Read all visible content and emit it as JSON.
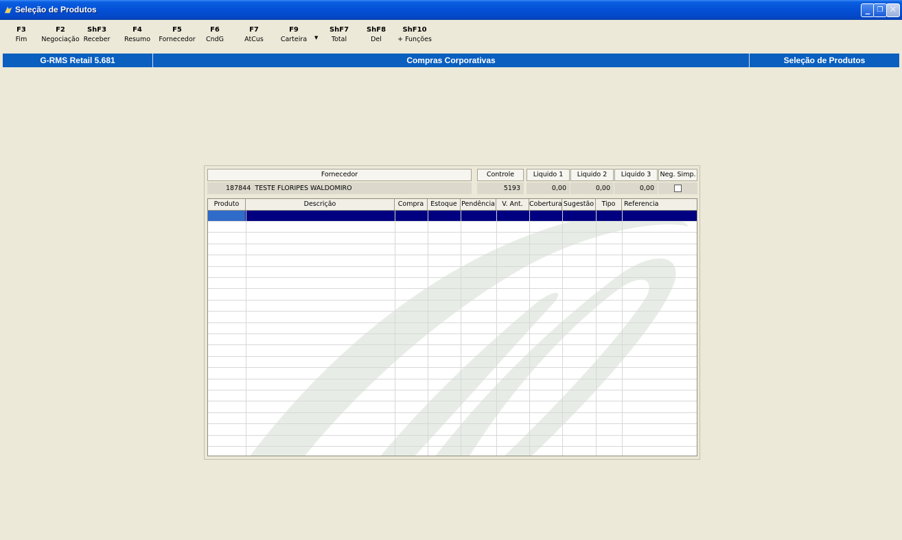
{
  "window": {
    "title": "Seleção de Produtos"
  },
  "toolbar": [
    {
      "key": "F3",
      "label": "Fim"
    },
    {
      "key": "F2",
      "label": "Negociação"
    },
    {
      "key": "ShF3",
      "label": "Receber"
    },
    {
      "key": "F4",
      "label": "Resumo"
    },
    {
      "key": "F5",
      "label": "Fornecedor"
    },
    {
      "key": "F6",
      "label": "CndG"
    },
    {
      "key": "F7",
      "label": "AtCus"
    },
    {
      "key": "F9",
      "label": "Carteira"
    },
    {
      "key": "ShF7",
      "label": "Total"
    },
    {
      "key": "ShF8",
      "label": "Del"
    },
    {
      "key": "ShF10",
      "label": "+ Funções"
    }
  ],
  "infobar": {
    "left": "G-RMS Retail 5.681",
    "center": "Compras Corporativas",
    "right": "Seleção de Produtos"
  },
  "header": {
    "fornecedor_label": "Fornecedor",
    "fornecedor_code": "187844",
    "fornecedor_name": "TESTE FLORIPES WALDOMIRO",
    "controle_label": "Controle",
    "controle_value": "5193",
    "liquido1_label": "Liquido 1",
    "liquido1_value": "0,00",
    "liquido2_label": "Liquido 2",
    "liquido2_value": "0,00",
    "liquido3_label": "Liquido 3",
    "liquido3_value": "0,00",
    "neg_simp_label": "Neg. Simp.",
    "neg_simp_checked": false
  },
  "grid": {
    "columns": [
      "Produto",
      "Descrição",
      "Compra",
      "Estoque",
      "Pendência",
      "V. Ant.",
      "Cobertura",
      "Sugestão",
      "Tipo",
      "Referencia"
    ],
    "rows": []
  },
  "colors": {
    "titlebar": "#0450d6",
    "infobar": "#0a5fbf",
    "selection": "#000080",
    "background": "#ece9d8"
  }
}
